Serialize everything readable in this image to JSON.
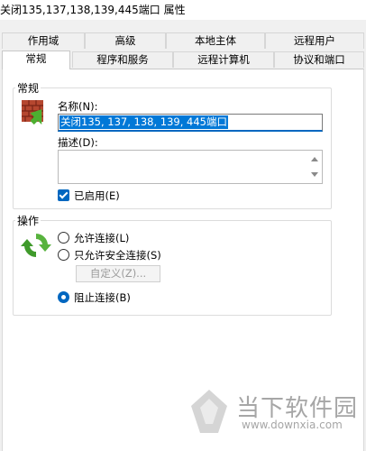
{
  "window": {
    "title": "关闭135,137,138,139,445端口 属性"
  },
  "tabs": {
    "row1": [
      "作用域",
      "高级",
      "本地主体",
      "远程用户"
    ],
    "row2": [
      "常规",
      "程序和服务",
      "远程计算机",
      "协议和端口"
    ]
  },
  "general": {
    "group_label": "常规",
    "name_label": "名称(N):",
    "name_value": "关闭135, 137, 138, 139, 445端口",
    "desc_label": "描述(D):",
    "desc_value": "",
    "enabled_label": "已启用(E)"
  },
  "action": {
    "group_label": "操作",
    "allow_label": "允许连接(L)",
    "allow_secure_label": "只允许安全连接(S)",
    "customize_label": "自定义(Z)...",
    "block_label": "阻止连接(B)",
    "selected": "block"
  },
  "watermark": {
    "brand": "当下软件园",
    "url": "www.downxia.com"
  },
  "icons": [
    "firewall-rule-icon",
    "refresh-arrows-icon",
    "watermark-logo-icon"
  ]
}
